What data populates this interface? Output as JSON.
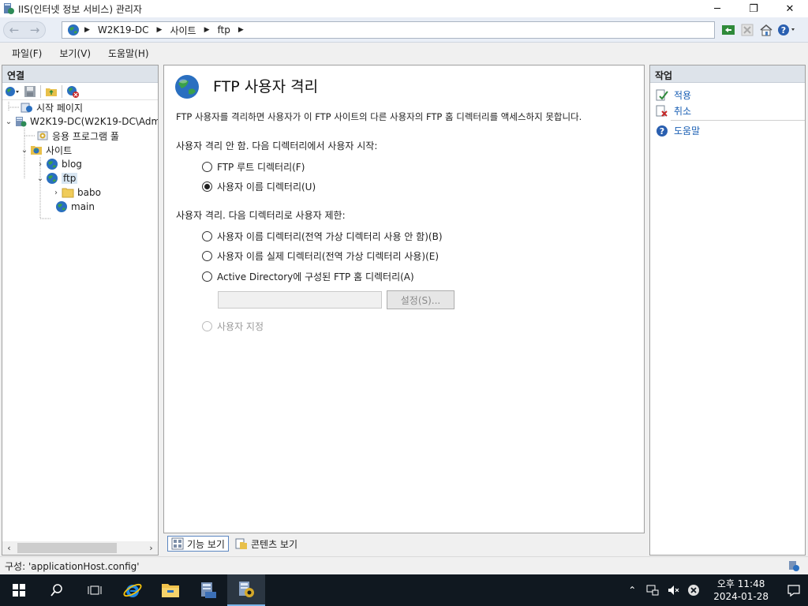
{
  "window": {
    "title": "IIS(인터넷 정보 서비스) 관리자",
    "controls": {
      "minimize": "─",
      "restore": "❐",
      "close": "✕"
    }
  },
  "address": {
    "back": "←",
    "forward": "→",
    "segments": [
      "W2K19-DC",
      "사이트",
      "ftp"
    ],
    "separator": "▶"
  },
  "menu": [
    "파일(F)",
    "보기(V)",
    "도움말(H)"
  ],
  "connections": {
    "title": "연결",
    "tree": [
      {
        "label": "시작 페이지",
        "icon": "start-page-icon"
      },
      {
        "label": "W2K19-DC(W2K19-DC\\Adm",
        "icon": "server-icon"
      },
      {
        "label": "응용 프로그램 풀",
        "icon": "app-pool-icon"
      },
      {
        "label": "사이트",
        "icon": "sites-folder-icon"
      },
      {
        "label": "blog",
        "icon": "globe-icon"
      },
      {
        "label": "ftp",
        "icon": "globe-icon"
      },
      {
        "label": "babo",
        "icon": "folder-icon"
      },
      {
        "label": "main",
        "icon": "globe-icon"
      }
    ],
    "expanders": {
      "collapsed": "›",
      "expanded": "⌄"
    },
    "scroll": {
      "left": "‹",
      "right": "›"
    }
  },
  "feature": {
    "title": "FTP 사용자 격리",
    "description": "FTP 사용자를 격리하면 사용자가 이 FTP 사이트의 다른 사용자의 FTP 홈 디렉터리를 액세스하지 못합니다.",
    "no_isolation_label": "사용자 격리 안 함. 다음 디렉터리에서 사용자 시작:",
    "isolation_label": "사용자 격리. 다음 디렉터리로 사용자 제한:",
    "options": {
      "ftp_root": "FTP 루트 디렉터리(F)",
      "user_name_dir": "사용자 이름 디렉터리(U)",
      "user_name_dir_no_global": "사용자 이름 디렉터리(전역 가상 디렉터리 사용 안 함)(B)",
      "user_name_physical": "사용자 이름 실제 디렉터리(전역 가상 디렉터리 사용)(E)",
      "active_directory": "Active Directory에 구성된 FTP 홈 디렉터리(A)",
      "custom": "사용자 지정"
    },
    "selected": "user_name_dir",
    "ad_value": "",
    "settings_button": "설정(S)..."
  },
  "view_tabs": {
    "features": "기능 보기",
    "content": "콘텐츠 보기"
  },
  "actions": {
    "title": "작업",
    "apply": "적용",
    "cancel": "취소",
    "help": "도움말"
  },
  "status": {
    "text": "구성: 'applicationHost.config'"
  },
  "taskbar": {
    "time": "오후 11:48",
    "date": "2024-01-28"
  },
  "colors": {
    "link": "#1a5fb4",
    "taskbar": "#101820",
    "panel_header": "#dde3ea"
  }
}
